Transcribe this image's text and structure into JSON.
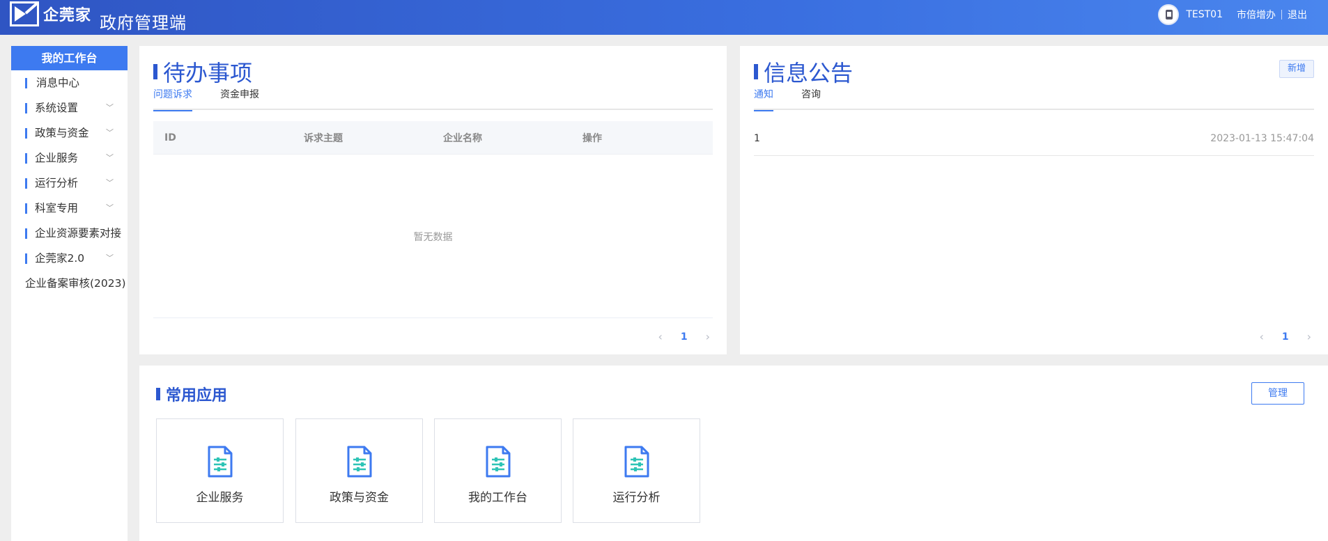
{
  "header": {
    "logo_text": "企莞家",
    "app_title": "政府管理端",
    "username": "TEST01",
    "office_link": "市倍增办",
    "logout_link": "退出"
  },
  "sidebar": {
    "active_label": "我的工作台",
    "items": [
      {
        "label": "消息中心"
      },
      {
        "label": "系统设置"
      },
      {
        "label": "政策与资金"
      },
      {
        "label": "企业服务"
      },
      {
        "label": "运行分析"
      },
      {
        "label": "科室专用"
      },
      {
        "label": "企业资源要素对接"
      },
      {
        "label": "企莞家2.0"
      },
      {
        "label": "企业备案审核(2023)"
      }
    ]
  },
  "todo": {
    "title": "待办事项",
    "tabs": [
      "问题诉求",
      "资金申报"
    ],
    "columns": [
      "ID",
      "诉求主题",
      "企业名称",
      "操作"
    ],
    "empty_text": "暂无数据",
    "pager": {
      "prev": "‹",
      "page": "1",
      "next": "›"
    }
  },
  "notice": {
    "title": "信息公告",
    "add_label": "新增",
    "tabs": [
      "通知",
      "咨询"
    ],
    "rows": [
      {
        "id": "1",
        "date": "2023-01-13 15:47:04"
      }
    ],
    "pager": {
      "prev": "‹",
      "page": "1",
      "next": "›"
    }
  },
  "apps": {
    "title": "常用应用",
    "manage_label": "管理",
    "items": [
      {
        "label": "企业服务",
        "icon": "document-settings-icon"
      },
      {
        "label": "政策与资金",
        "icon": "document-settings-icon"
      },
      {
        "label": "我的工作台",
        "icon": "document-settings-icon"
      },
      {
        "label": "运行分析",
        "icon": "document-settings-icon"
      }
    ]
  },
  "colors": {
    "primary": "#3d7af0",
    "title_blue": "#2c58d0",
    "header_start": "#2f55c3",
    "header_end": "#4a86ee",
    "icon_teal": "#2ec4b6"
  }
}
